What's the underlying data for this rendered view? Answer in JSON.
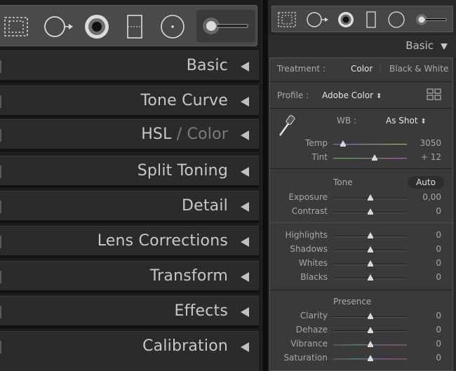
{
  "tools_left": [
    "crop-overlay-icon",
    "spot-removal-icon",
    "red-eye-icon",
    "graduated-filter-icon",
    "radial-filter-icon",
    "adjustment-brush-icon"
  ],
  "left_panels": [
    {
      "label": "Basic"
    },
    {
      "label": "Tone Curve"
    },
    {
      "label": "HSL",
      "label_dim": " / Color"
    },
    {
      "label": "Split Toning"
    },
    {
      "label": "Detail"
    },
    {
      "label": "Lens Corrections"
    },
    {
      "label": "Transform"
    },
    {
      "label": "Effects"
    },
    {
      "label": "Calibration"
    }
  ],
  "basic": {
    "title": "Basic",
    "treatment_label": "Treatment :",
    "treatment_color": "Color",
    "treatment_bw": "Black & White",
    "profile_label": "Profile :",
    "profile_value": "Adobe Color",
    "profile_arrows": "⬍",
    "wb_label": "WB :",
    "wb_value": "As Shot",
    "tone_label": "Tone",
    "auto_label": "Auto",
    "presence_label": "Presence",
    "sliders_wb": [
      {
        "label": "Temp",
        "value": "3050",
        "pos": 0.13,
        "gradient": "linear-gradient(90deg,#4f6fd6,#b8b84a)"
      },
      {
        "label": "Tint",
        "value": "+ 12",
        "pos": 0.56,
        "gradient": "linear-gradient(90deg,#4ab84a,#b84ab8)"
      }
    ],
    "sliders_tone": [
      {
        "label": "Exposure",
        "value": "0,00",
        "pos": 0.5
      },
      {
        "label": "Contrast",
        "value": "0",
        "pos": 0.5
      }
    ],
    "sliders_tone2": [
      {
        "label": "Highlights",
        "value": "0",
        "pos": 0.5
      },
      {
        "label": "Shadows",
        "value": "0",
        "pos": 0.5
      },
      {
        "label": "Whites",
        "value": "0",
        "pos": 0.5
      },
      {
        "label": "Blacks",
        "value": "0",
        "pos": 0.5
      }
    ],
    "sliders_presence": [
      {
        "label": "Clarity",
        "value": "0",
        "pos": 0.5
      },
      {
        "label": "Dehaze",
        "value": "0",
        "pos": 0.5
      },
      {
        "label": "Vibrance",
        "value": "0",
        "pos": 0.5,
        "gradient": "linear-gradient(90deg,#555,#4a8a9a,#8a4a9a,#9a4a4a)"
      },
      {
        "label": "Saturation",
        "value": "0",
        "pos": 0.5,
        "gradient": "linear-gradient(90deg,#555,#4a8a9a,#8a4a9a,#9a4a4a)"
      }
    ]
  },
  "colors": {
    "text": "#c8c8c8",
    "panel_bg": "#2b2b2b",
    "basic_bg": "#3a3a3a"
  }
}
